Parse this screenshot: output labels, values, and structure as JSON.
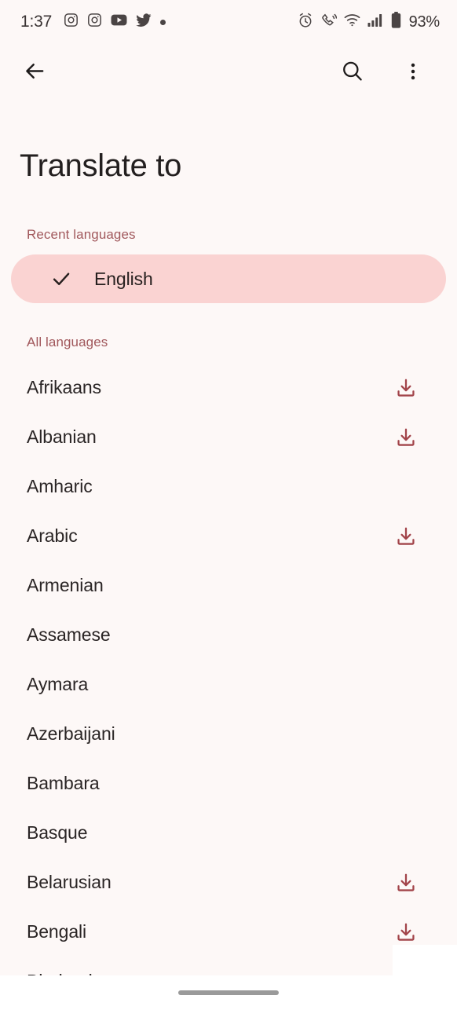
{
  "status_bar": {
    "time": "1:37",
    "battery_percent": "93%",
    "left_icons": [
      "instagram-icon",
      "instagram-icon",
      "youtube-icon",
      "twitter-icon",
      "dot-icon"
    ],
    "right_icons": [
      "alarm-icon",
      "call-vibrate-icon",
      "wifi-icon",
      "signal-bars-icon",
      "battery-icon"
    ]
  },
  "app_bar": {
    "back_label": "Back",
    "search_label": "Search",
    "overflow_label": "More options",
    "icons": {
      "back": "arrow-back-icon",
      "search": "search-icon",
      "overflow": "more-vert-icon"
    }
  },
  "header": {
    "title": "Translate to"
  },
  "sections": {
    "recent": {
      "label": "Recent languages",
      "items": [
        {
          "name": "English",
          "selected": true,
          "downloadable": false
        }
      ]
    },
    "all": {
      "label": "All languages",
      "items": [
        {
          "name": "Afrikaans",
          "selected": false,
          "downloadable": true
        },
        {
          "name": "Albanian",
          "selected": false,
          "downloadable": true
        },
        {
          "name": "Amharic",
          "selected": false,
          "downloadable": false
        },
        {
          "name": "Arabic",
          "selected": false,
          "downloadable": true
        },
        {
          "name": "Armenian",
          "selected": false,
          "downloadable": false
        },
        {
          "name": "Assamese",
          "selected": false,
          "downloadable": false
        },
        {
          "name": "Aymara",
          "selected": false,
          "downloadable": false
        },
        {
          "name": "Azerbaijani",
          "selected": false,
          "downloadable": false
        },
        {
          "name": "Bambara",
          "selected": false,
          "downloadable": false
        },
        {
          "name": "Basque",
          "selected": false,
          "downloadable": false
        },
        {
          "name": "Belarusian",
          "selected": false,
          "downloadable": true
        },
        {
          "name": "Bengali",
          "selected": false,
          "downloadable": true
        },
        {
          "name": "Bhojpuri",
          "selected": false,
          "downloadable": false
        }
      ]
    }
  },
  "icons": {
    "download": "download-icon",
    "check": "check-icon",
    "gesture_bar": "gesture-home-bar"
  },
  "colors": {
    "background": "#FDF8F7",
    "selected_pill": "#FAD3D2",
    "section_header_text": "#A1585C",
    "download_icon": "#A2444A",
    "primary_text": "#2A2525",
    "title_text": "#231F1F",
    "gesture_bar": "#9A9A9A"
  }
}
